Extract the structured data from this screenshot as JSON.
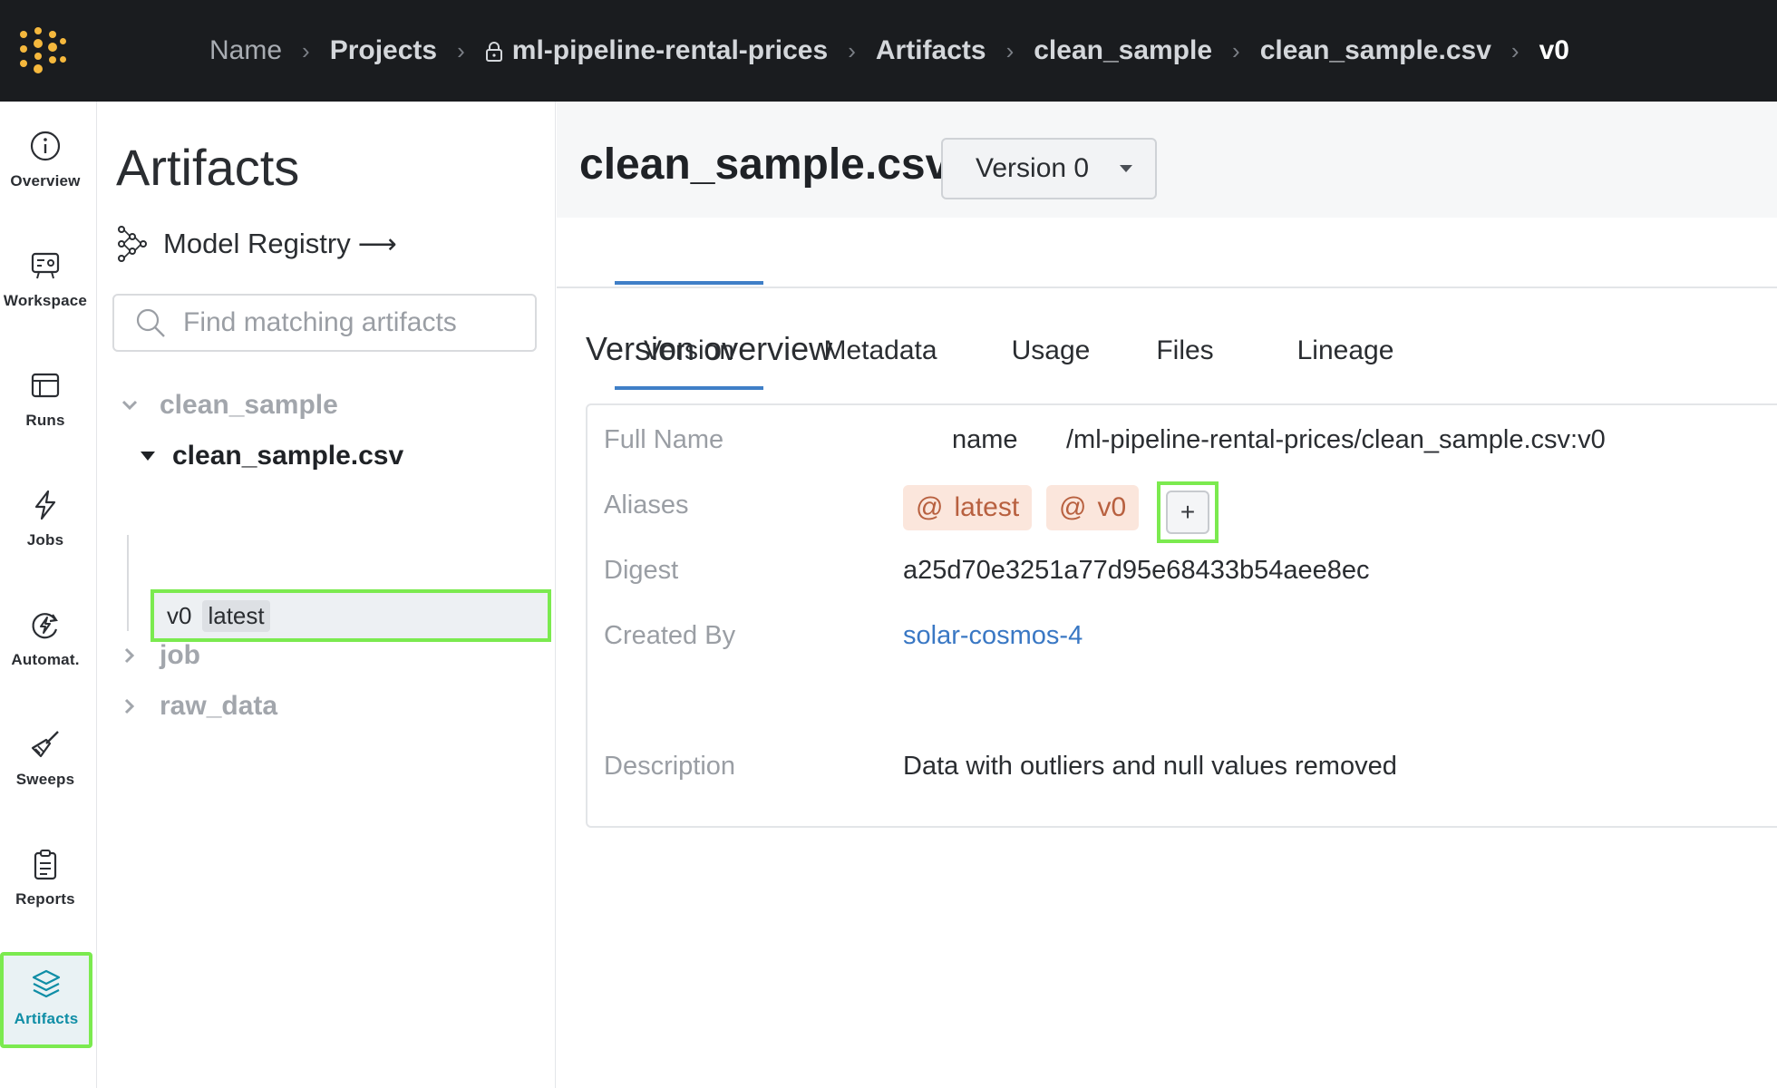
{
  "breadcrumbs": [
    {
      "label": "Name"
    },
    {
      "label": "Projects"
    },
    {
      "label": "ml-pipeline-rental-prices"
    },
    {
      "label": "Artifacts"
    },
    {
      "label": "clean_sample"
    },
    {
      "label": "clean_sample.csv"
    },
    {
      "label": "v0"
    }
  ],
  "leftnav": {
    "items": [
      {
        "label": "Overview",
        "icon": "info-icon"
      },
      {
        "label": "Workspace",
        "icon": "workspace-icon"
      },
      {
        "label": "Runs",
        "icon": "runs-icon"
      },
      {
        "label": "Jobs",
        "icon": "lightning-icon"
      },
      {
        "label": "Automat.",
        "icon": "automation-icon"
      },
      {
        "label": "Sweeps",
        "icon": "broom-icon"
      },
      {
        "label": "Reports",
        "icon": "clipboard-icon"
      },
      {
        "label": "Artifacts",
        "icon": "layers-icon",
        "active": true
      }
    ]
  },
  "sidepanel": {
    "title": "Artifacts",
    "registry_label": "Model Registry",
    "registry_arrow": "⟶",
    "search_placeholder": "Find matching artifacts",
    "tree": {
      "group1": "clean_sample",
      "artifact": "clean_sample.csv",
      "version": "v0",
      "version_alias": "latest",
      "group2": "job",
      "group3": "raw_data"
    }
  },
  "main": {
    "title": "clean_sample.csv",
    "version_select": "Version 0",
    "tabs": [
      {
        "label": "Version",
        "active": true
      },
      {
        "label": "Metadata"
      },
      {
        "label": "Usage"
      },
      {
        "label": "Files"
      },
      {
        "label": "Lineage"
      }
    ],
    "section_title": "Version overview",
    "fields": {
      "full_name_label": "Full Name",
      "full_name_entity": "name",
      "full_name_path": "/ml-pipeline-rental-prices/clean_sample.csv:v0",
      "aliases_label": "Aliases",
      "aliases": [
        "latest",
        "v0"
      ],
      "alias_symbol": "@",
      "add_alias": "+",
      "digest_label": "Digest",
      "digest_value": "a25d70e3251a77d95e68433b54aee8ec",
      "created_by_label": "Created By",
      "created_by_value": "solar-cosmos-4",
      "description_label": "Description",
      "description_value": "Data with outliers and null values removed"
    }
  },
  "colors": {
    "topbar": "#1a1c1f",
    "highlight": "#7bea4f",
    "accent": "#3f7fc7",
    "alias_bg": "#fbe6dc",
    "alias_text": "#b8603f",
    "link": "#3a78c4"
  }
}
